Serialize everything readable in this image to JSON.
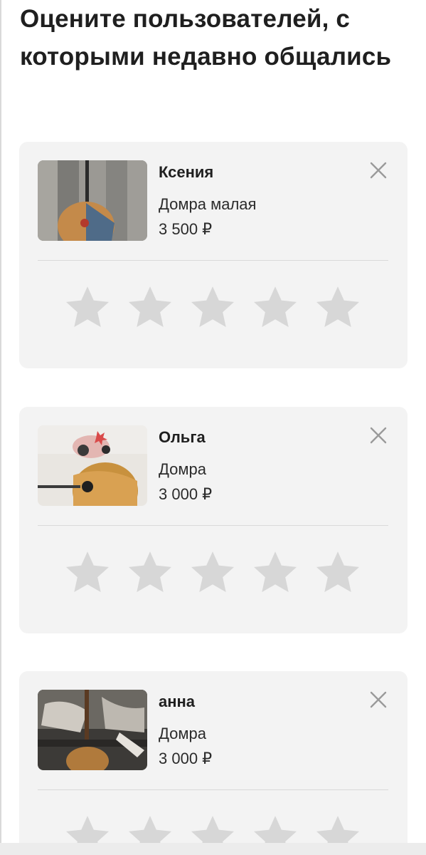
{
  "page": {
    "heading": "Оцените пользователей, с которыми недавно общались"
  },
  "cards": [
    {
      "user_name": "Ксения",
      "item_title": "Домра малая",
      "item_price": "3 500 ₽",
      "thumbnail": "domra-photo-1",
      "rating_stars": 5
    },
    {
      "user_name": "Ольга",
      "item_title": "Домра",
      "item_price": "3 000 ₽",
      "thumbnail": "domra-photo-2",
      "rating_stars": 5
    },
    {
      "user_name": "анна",
      "item_title": "Домра",
      "item_price": "3 000 ₽",
      "thumbnail": "domra-photo-3",
      "rating_stars": 5
    }
  ],
  "icons": {
    "close": "close-icon",
    "star": "star-icon"
  },
  "colors": {
    "card_background": "#f3f3f3",
    "star_empty": "#d7d7d7",
    "close_icon": "#9a9a9a"
  }
}
